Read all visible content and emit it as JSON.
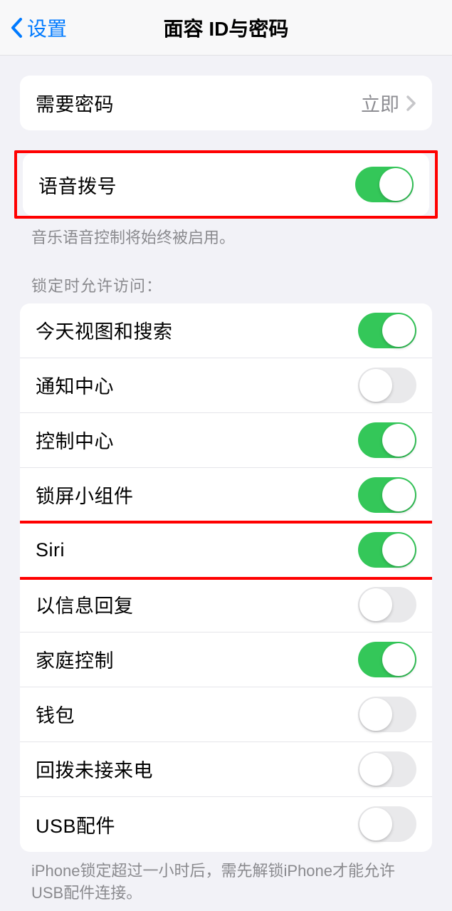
{
  "header": {
    "back_label": "设置",
    "title": "面容 ID与密码"
  },
  "passcode_row": {
    "label": "需要密码",
    "value": "立即"
  },
  "voice_dial": {
    "label": "语音拨号",
    "on": true,
    "footer": "音乐语音控制将始终被启用。"
  },
  "allow_access_header": "锁定时允许访问：",
  "access_items": [
    {
      "label": "今天视图和搜索",
      "on": true
    },
    {
      "label": "通知中心",
      "on": false
    },
    {
      "label": "控制中心",
      "on": true
    },
    {
      "label": "锁屏小组件",
      "on": true
    },
    {
      "label": "Siri",
      "on": true
    },
    {
      "label": "以信息回复",
      "on": false
    },
    {
      "label": "家庭控制",
      "on": true
    },
    {
      "label": "钱包",
      "on": false
    },
    {
      "label": "回拨未接来电",
      "on": false
    },
    {
      "label": "USB配件",
      "on": false
    }
  ],
  "usb_footer": "iPhone锁定超过一小时后，需先解锁iPhone才能允许USB配件连接。"
}
